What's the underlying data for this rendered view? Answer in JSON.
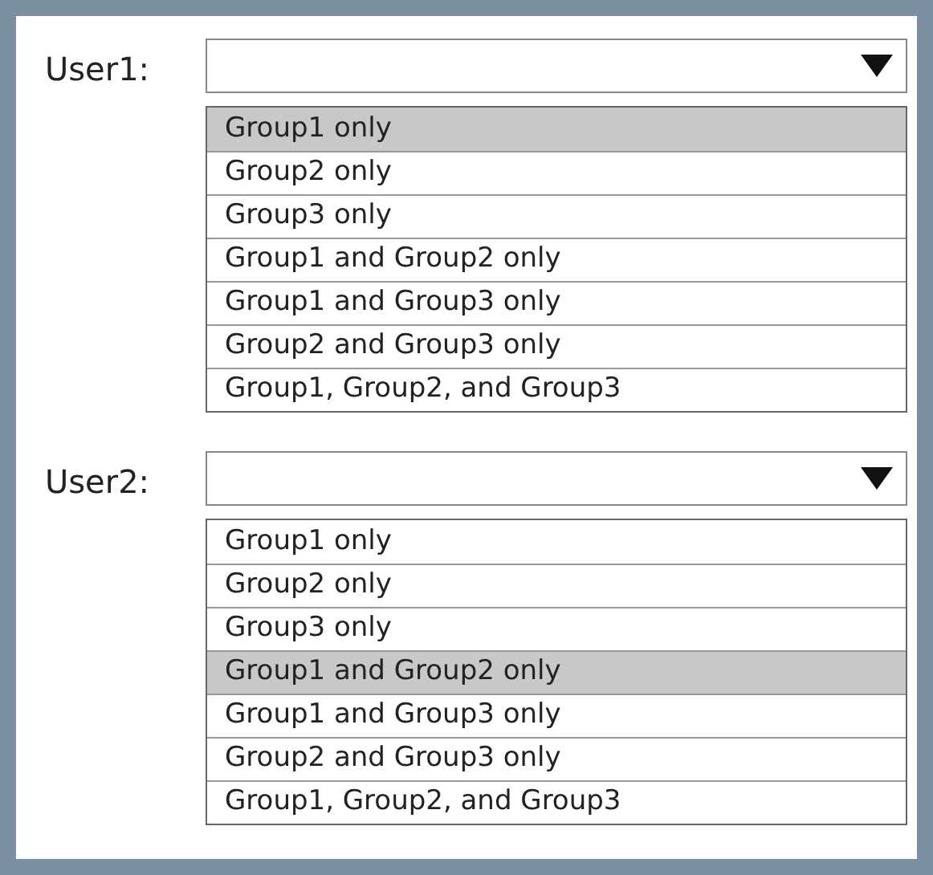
{
  "questions": [
    {
      "label": "User1:",
      "options": [
        {
          "label": "Group1 only",
          "selected": true
        },
        {
          "label": "Group2 only",
          "selected": false
        },
        {
          "label": "Group3 only",
          "selected": false
        },
        {
          "label": "Group1 and Group2 only",
          "selected": false
        },
        {
          "label": "Group1 and Group3 only",
          "selected": false
        },
        {
          "label": "Group2 and Group3 only",
          "selected": false
        },
        {
          "label": "Group1, Group2, and Group3",
          "selected": false
        }
      ]
    },
    {
      "label": "User2:",
      "options": [
        {
          "label": "Group1 only",
          "selected": false
        },
        {
          "label": "Group2 only",
          "selected": false
        },
        {
          "label": "Group3 only",
          "selected": false
        },
        {
          "label": "Group1 and Group2 only",
          "selected": true
        },
        {
          "label": "Group1 and Group3 only",
          "selected": false
        },
        {
          "label": "Group2 and Group3 only",
          "selected": false
        },
        {
          "label": "Group1, Group2, and Group3",
          "selected": false
        }
      ]
    }
  ]
}
